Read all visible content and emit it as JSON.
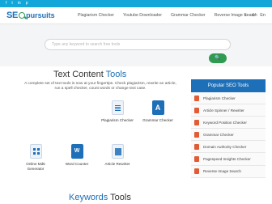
{
  "topbar": {
    "social": [
      "f",
      "t",
      "in",
      "p"
    ],
    "lang": "▣ EN"
  },
  "nav": {
    "logo": {
      "part1": "SE",
      "part2": "pursuits"
    },
    "links": [
      "Plagiarism Checker",
      "Youtube Downloader",
      "Grammar Checker",
      "Reverse Image Search"
    ],
    "icons": [
      "≡",
      "⊕",
      "En"
    ]
  },
  "hero": {
    "search_placeholder": "Type any keyword to search free tools",
    "search_button_icon": "search-icon",
    "search_button_glyph": "🔍"
  },
  "main": {
    "heading_text": "Text Content",
    "heading_accent": " Tools",
    "description": "A complete set of text tools is now at your fingertips. Check plagiarism, rewrite an article, run a spell checker, count words or change text case.",
    "tiles": [
      {
        "label": "Plagiarism Checker",
        "icon": "document-icon",
        "glyph": ""
      },
      {
        "label": "Grammar Checker",
        "icon": "grammar-a-icon",
        "glyph": "A"
      },
      {
        "label": "Online Md5 Generator",
        "icon": "grid-icon",
        "glyph": ""
      },
      {
        "label": "Word Counter",
        "icon": "word-icon",
        "glyph": "W"
      },
      {
        "label": "Article Rewriter",
        "icon": "article-icon",
        "glyph": ""
      }
    ],
    "keywords_text": "Keywords",
    "keywords_accent": " Tools"
  },
  "sidebar": {
    "title": "Popular SEO Tools",
    "items": [
      "Plagiarism Checker",
      "Article Spinner / Rewriter",
      "Keyword Position Checker",
      "Grammar Checker",
      "Domain Authority Checker",
      "Pagespeed Insights Checker",
      "Reverse Image Search"
    ],
    "icon_color": "#e25b34"
  },
  "colors": {
    "brand_blue": "#1d6fb8",
    "topbar": "#13a6d8",
    "accent_green": "#2f9a52"
  }
}
